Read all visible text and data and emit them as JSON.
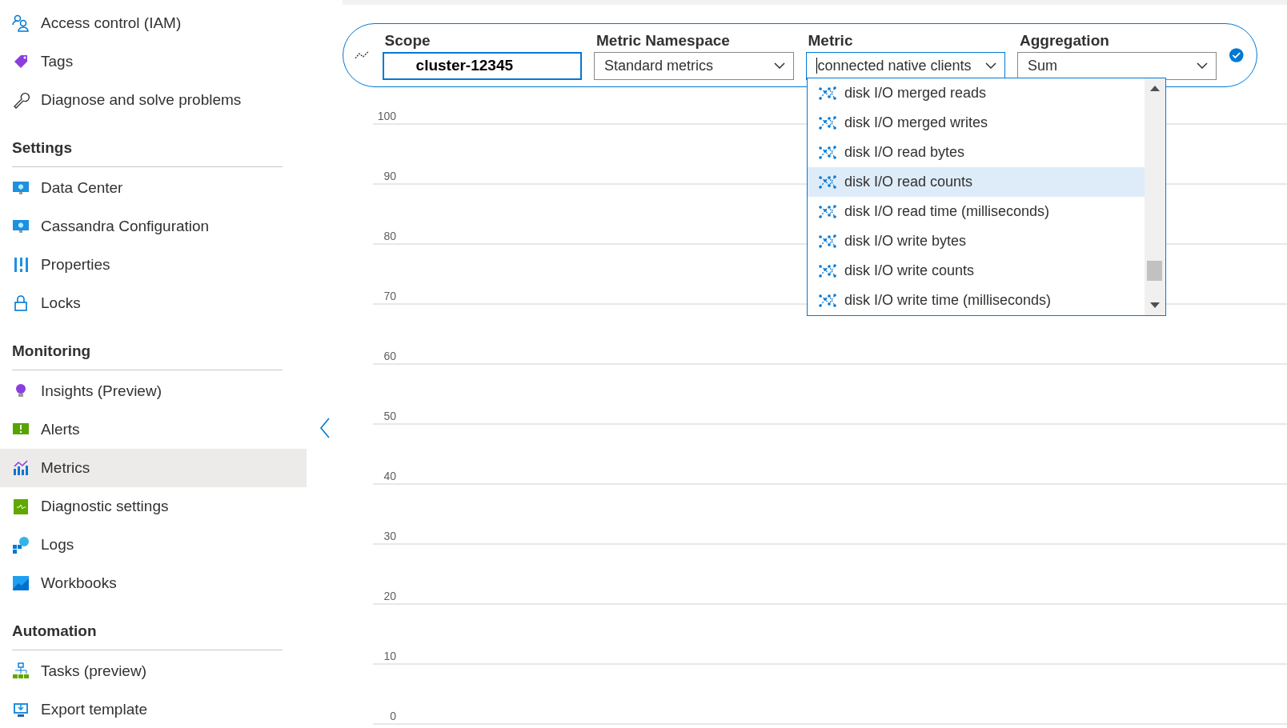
{
  "sidebar": {
    "groups": [
      {
        "items": [
          {
            "label": "Access control (IAM)",
            "selected": false
          },
          {
            "label": "Tags",
            "selected": false
          },
          {
            "label": "Diagnose and solve problems",
            "selected": false
          }
        ]
      },
      {
        "heading": "Settings",
        "items": [
          {
            "label": "Data Center",
            "selected": false
          },
          {
            "label": "Cassandra Configuration",
            "selected": false
          },
          {
            "label": "Properties",
            "selected": false
          },
          {
            "label": "Locks",
            "selected": false
          }
        ]
      },
      {
        "heading": "Monitoring",
        "items": [
          {
            "label": "Insights (Preview)",
            "selected": false
          },
          {
            "label": "Alerts",
            "selected": false
          },
          {
            "label": "Metrics",
            "selected": true
          },
          {
            "label": "Diagnostic settings",
            "selected": false
          },
          {
            "label": "Logs",
            "selected": false
          },
          {
            "label": "Workbooks",
            "selected": false
          }
        ]
      },
      {
        "heading": "Automation",
        "items": [
          {
            "label": "Tasks (preview)",
            "selected": false
          },
          {
            "label": "Export template",
            "selected": false
          }
        ]
      }
    ]
  },
  "metric_bar": {
    "fields": [
      {
        "kind": "input",
        "label": "Scope",
        "value": "cluster-12345"
      },
      {
        "kind": "select",
        "label": "Metric Namespace",
        "value": "Standard metrics",
        "focused": false
      },
      {
        "kind": "select",
        "label": "Metric",
        "value": "connected native clients",
        "focused": true
      },
      {
        "kind": "select",
        "label": "Aggregation",
        "value": "Sum",
        "focused": false
      }
    ]
  },
  "metric_dropdown": {
    "options": [
      {
        "label": "disk I/O merged reads",
        "selected": false
      },
      {
        "label": "disk I/O merged writes",
        "selected": false
      },
      {
        "label": "disk I/O read bytes",
        "selected": false
      },
      {
        "label": "disk I/O read counts",
        "selected": true
      },
      {
        "label": "disk I/O read time (milliseconds)",
        "selected": false
      },
      {
        "label": "disk I/O write bytes",
        "selected": false
      },
      {
        "label": "disk I/O write counts",
        "selected": false
      },
      {
        "label": "disk I/O write time (milliseconds)",
        "selected": false
      }
    ]
  },
  "chart": {
    "y_axis_labels": [
      "100",
      "90",
      "80",
      "70",
      "60",
      "50",
      "40",
      "30",
      "20",
      "10",
      "0"
    ]
  }
}
